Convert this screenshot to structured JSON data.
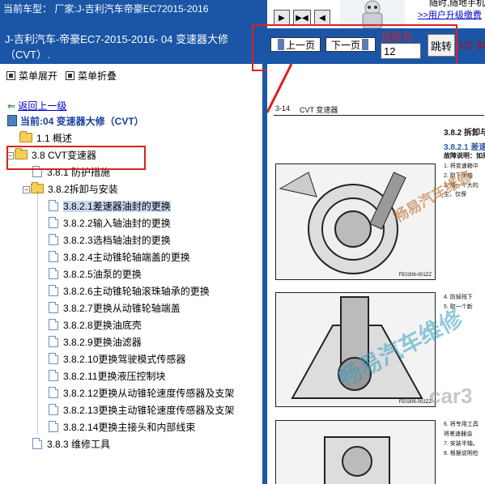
{
  "header": {
    "current_model": "当前车型： 厂家:J-吉利汽车帝豪EC72015-2016",
    "nav_first": "▶",
    "nav_middle": "▶◀",
    "nav_last": "◀"
  },
  "ad": {
    "line1": "随时,随地手机查",
    "link": ">>用户升级缴费"
  },
  "left_title": "J-吉利汽车-帝豪EC7-2015-2016- 04 变速器大修（CVT）.",
  "menu": {
    "expand": "菜单展开",
    "collapse": "菜单折叠"
  },
  "tree": {
    "back_link": "返回上一级",
    "root": "当前:04 变速器大修（CVT）",
    "items": [
      {
        "label": "1.1 概述"
      },
      {
        "label": "3.8 CVT变速器"
      },
      {
        "label": "3.8.1 防护措施"
      },
      {
        "label": "3.8.2拆卸与安装"
      },
      {
        "label": "3.8.2.1差速器油封的更换"
      },
      {
        "label": "3.8.2.2输入轴油封的更换"
      },
      {
        "label": "3.8.2.3选档轴油封的更换"
      },
      {
        "label": "3.8.2.4主动锥轮轴端盖的更换"
      },
      {
        "label": "3.8.2.5油泵的更换"
      },
      {
        "label": "3.8.2.6主动锥轮轴滚珠轴承的更换"
      },
      {
        "label": "3.8.2.7更换从动锥轮轴端盖"
      },
      {
        "label": "3.8.2.8更换油底壳"
      },
      {
        "label": "3.8.2.9更换油滤器"
      },
      {
        "label": "3.8.2.10更换驾驶模式传感器"
      },
      {
        "label": "3.8.2.11更换液压控制块"
      },
      {
        "label": "3.8.2.12更换从动锥轮速度传感器及支架"
      },
      {
        "label": "3.8.2.13更换主动锥轮速度传感器及支架"
      },
      {
        "label": "3.8.2.14更换主接头和内部线束"
      },
      {
        "label": "3.8.3 维修工具"
      }
    ]
  },
  "pager": {
    "prev": "上一页",
    "next": "下一页",
    "current_label": "当前为",
    "current_value": "12",
    "jump": "跳转",
    "count": "12/ 32"
  },
  "document": {
    "page_no": "3-14",
    "section": "CVT 变速器",
    "heading1": "3.8.2 拆卸与",
    "heading2": "3.8.2.1 差速",
    "fault": "故障说明：如果",
    "steps_a": [
      "1.  将变速箱中",
      "2.  取下半轴",
      "3.  用一个大的",
      "    主，仅保"
    ],
    "fig1_code": "FE0306-001ZZ",
    "fig1_step": "4.  防掉残下",
    "fig1_step2": "5.  取一个新",
    "fig2_code": "FE0306-002ZZ",
    "steps_b": [
      "6.  将专用工具",
      "    将差速器油",
      "7.  安装半轴。",
      "8.  根据说明检"
    ],
    "watermark1": "畅易汽车维修",
    "watermark2": "畅易汽车维修",
    "watermark3": "car3"
  },
  "colors": {
    "header_blue": "#1a55a6",
    "highlight_red": "#e02020"
  }
}
